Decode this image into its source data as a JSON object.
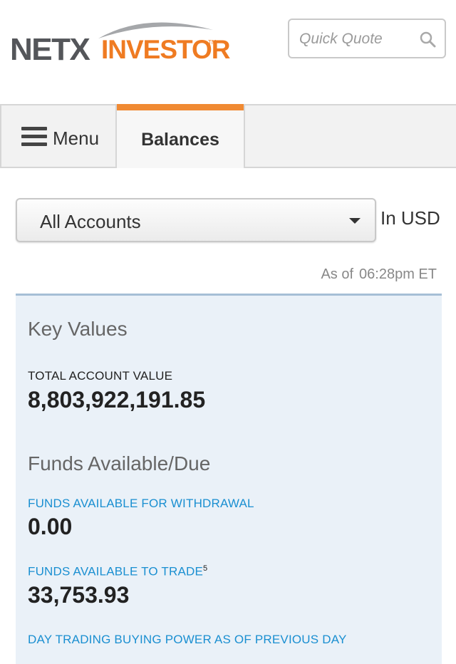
{
  "header": {
    "logo": {
      "part1": "NETX",
      "part2": "INVESTOR",
      "tm": "TM"
    },
    "quick_quote": {
      "placeholder": "Quick Quote",
      "value": "",
      "icon": "search-icon"
    }
  },
  "tabs": {
    "menu": {
      "label": "Menu",
      "icon": "hamburger-menu-icon"
    },
    "balances": {
      "label": "Balances",
      "active": true
    }
  },
  "account_select": {
    "selected": "All Accounts",
    "currency": "In USD"
  },
  "timestamp": {
    "prefix": "As of",
    "time": "06:28pm ET"
  },
  "key_values": {
    "heading": "Key Values",
    "total_label": "TOTAL ACCOUNT VALUE",
    "total_value": "8,803,922,191.85"
  },
  "funds": {
    "heading": "Funds Available/Due",
    "withdrawal_label": "FUNDS AVAILABLE FOR WITHDRAWAL",
    "withdrawal_value": "0.00",
    "trade_label": "FUNDS AVAILABLE TO TRADE",
    "trade_sup": "5",
    "trade_value": "33,753.93",
    "daytrade_label": "DAY TRADING BUYING POWER AS OF PREVIOUS DAY"
  },
  "colors": {
    "accent": "#ef7b22",
    "link": "#1a8fd1",
    "panel": "#eaf1f8"
  }
}
